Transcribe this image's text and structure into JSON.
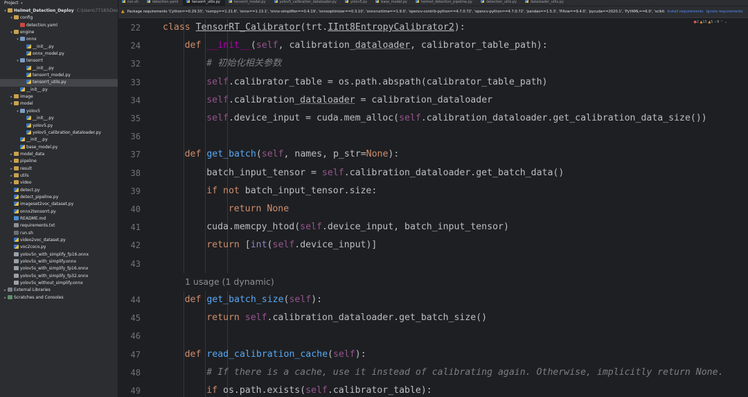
{
  "project": {
    "title": "Project",
    "tree": [
      {
        "indent": 0,
        "arrow": "▾",
        "icon": "folder",
        "label": "Helmet_Detection_Deploy",
        "hint": "C:\\Users\\77183\\Desktop\\He",
        "bold": true
      },
      {
        "indent": 1,
        "arrow": "▾",
        "icon": "folder",
        "label": "config"
      },
      {
        "indent": 2,
        "arrow": "",
        "icon": "yaml",
        "label": "detection.yaml"
      },
      {
        "indent": 1,
        "arrow": "▾",
        "icon": "folder",
        "label": "engine"
      },
      {
        "indent": 2,
        "arrow": "▾",
        "icon": "folder",
        "label": "onnx"
      },
      {
        "indent": 3,
        "arrow": "",
        "icon": "py",
        "label": "__init__.py"
      },
      {
        "indent": 3,
        "arrow": "",
        "icon": "py",
        "label": "onnx_model.py"
      },
      {
        "indent": 2,
        "arrow": "▾",
        "icon": "folder",
        "label": "tensorrt"
      },
      {
        "indent": 3,
        "arrow": "",
        "icon": "py",
        "label": "__init__.py"
      },
      {
        "indent": 3,
        "arrow": "",
        "icon": "py",
        "label": "tensorrt_model.py"
      },
      {
        "indent": 3,
        "arrow": "",
        "icon": "py",
        "label": "tensorrt_utils.py",
        "selected": true
      },
      {
        "indent": 2,
        "arrow": "",
        "icon": "py",
        "label": "__init__.py"
      },
      {
        "indent": 1,
        "arrow": "▸",
        "icon": "folder",
        "label": "image"
      },
      {
        "indent": 1,
        "arrow": "▾",
        "icon": "folder",
        "label": "model"
      },
      {
        "indent": 2,
        "arrow": "▾",
        "icon": "folder",
        "label": "yolov5"
      },
      {
        "indent": 3,
        "arrow": "",
        "icon": "py",
        "label": "__init__.py"
      },
      {
        "indent": 3,
        "arrow": "",
        "icon": "py",
        "label": "yolov5.py"
      },
      {
        "indent": 3,
        "arrow": "",
        "icon": "py",
        "label": "yolov5_calibration_dataloader.py"
      },
      {
        "indent": 2,
        "arrow": "",
        "icon": "py",
        "label": "__init__.py"
      },
      {
        "indent": 2,
        "arrow": "",
        "icon": "py",
        "label": "base_model.py"
      },
      {
        "indent": 1,
        "arrow": "▸",
        "icon": "folder",
        "label": "model_data"
      },
      {
        "indent": 1,
        "arrow": "▸",
        "icon": "folder",
        "label": "pipeline"
      },
      {
        "indent": 1,
        "arrow": "▸",
        "icon": "folder",
        "label": "result"
      },
      {
        "indent": 1,
        "arrow": "▸",
        "icon": "folder",
        "label": "utils"
      },
      {
        "indent": 1,
        "arrow": "▸",
        "icon": "folder",
        "label": "video"
      },
      {
        "indent": 1,
        "arrow": "",
        "icon": "py",
        "label": "detect.py"
      },
      {
        "indent": 1,
        "arrow": "",
        "icon": "py",
        "label": "detect_pipeline.py"
      },
      {
        "indent": 1,
        "arrow": "",
        "icon": "py",
        "label": "imageset2voc_dataset.py"
      },
      {
        "indent": 1,
        "arrow": "",
        "icon": "py",
        "label": "onnx2tensorrt.py"
      },
      {
        "indent": 1,
        "arrow": "",
        "icon": "md",
        "label": "README.md"
      },
      {
        "indent": 1,
        "arrow": "",
        "icon": "txt",
        "label": "requirements.txt"
      },
      {
        "indent": 1,
        "arrow": "",
        "icon": "sh",
        "label": "run.sh"
      },
      {
        "indent": 1,
        "arrow": "",
        "icon": "py",
        "label": "video2voc_dataset.py"
      },
      {
        "indent": 1,
        "arrow": "",
        "icon": "py",
        "label": "voc2coco.py"
      },
      {
        "indent": 1,
        "arrow": "",
        "icon": "onnx",
        "label": "yolov5n_with_simplify_fp16.onnx"
      },
      {
        "indent": 1,
        "arrow": "",
        "icon": "onnx",
        "label": "yolov5s_with_simplify.onnx"
      },
      {
        "indent": 1,
        "arrow": "",
        "icon": "onnx",
        "label": "yolov5s_with_simplify_fp16.onnx"
      },
      {
        "indent": 1,
        "arrow": "",
        "icon": "onnx",
        "label": "yolov5s_with_simplify_fp32.onnx"
      },
      {
        "indent": 1,
        "arrow": "",
        "icon": "onnx",
        "label": "yolov5s_without_simplify.onnx"
      },
      {
        "indent": 0,
        "arrow": "▸",
        "icon": "lib",
        "label": "External Libraries"
      },
      {
        "indent": 0,
        "arrow": "▸",
        "icon": "scratch",
        "label": "Scratches and Consoles"
      }
    ]
  },
  "tabs": [
    {
      "label": "run.sh"
    },
    {
      "label": "detection.yaml"
    },
    {
      "label": "tensorrt_utils.py",
      "active": true
    },
    {
      "label": "tensorrt_model.py"
    },
    {
      "label": "yolov5_calibration_dataloader.py"
    },
    {
      "label": "yolov5.py"
    },
    {
      "label": "base_model.py"
    },
    {
      "label": "helmet_detection_pipeline.py"
    },
    {
      "label": "detection_utils.py"
    },
    {
      "label": "dataloader_utils.py"
    }
  ],
  "banner": {
    "text": "Package requirements 'Cython==0.29.33', 'numpy==1.21.6', 'onnx==1.13.1', 'onnx-simplifier==0.4.19', 'onnxoptimizer==0.3.10', 'onnxruntime==1.9.0', 'opencv-contrib-python==4.7.0.72', 'opencv-python==4.7.0.72', 'pandas==1.5.3', 'Pillow==9.4.0', 'pycuda==2020.1', 'PyYAML==6.0', 'scikit-learn==1...",
    "install": "Install requirements",
    "ignore": "Ignore requirements"
  },
  "inspection": {
    "errors": "2",
    "warnings": "15",
    "weak": "5",
    "ok": "8"
  },
  "usage_hint": "1 usage (1 dynamic)",
  "code_lines": [
    {
      "num": "22",
      "indent": 0,
      "tokens": [
        [
          "kw",
          "class "
        ],
        [
          "cls",
          "TensorRT_Calibrator"
        ],
        [
          "",
          "(trt."
        ],
        [
          "cls",
          "IInt8EntropyCalibrator2"
        ],
        [
          "",
          "):"
        ]
      ]
    },
    {
      "num": "24",
      "indent": 1,
      "tokens": [
        [
          "kw",
          "def "
        ],
        [
          "dunder",
          "__init__"
        ],
        [
          "",
          "("
        ],
        [
          "selfc",
          "self"
        ],
        [
          "",
          ", calibration_"
        ],
        [
          "ul",
          "dataloader"
        ],
        [
          "",
          ", calibrator_table_path):"
        ]
      ]
    },
    {
      "num": "32",
      "indent": 2,
      "tokens": [
        [
          "cm",
          "# 初始化相关参数"
        ]
      ]
    },
    {
      "num": "33",
      "indent": 2,
      "tokens": [
        [
          "selfc",
          "self"
        ],
        [
          "",
          ".calibrator_table = os.path.abspath(calibrator_table_path)"
        ]
      ]
    },
    {
      "num": "34",
      "indent": 2,
      "tokens": [
        [
          "selfc",
          "self"
        ],
        [
          "",
          ".calibration_"
        ],
        [
          "ul",
          "dataloader"
        ],
        [
          "",
          " = calibration_dataloader"
        ]
      ]
    },
    {
      "num": "35",
      "indent": 2,
      "tokens": [
        [
          "selfc",
          "self"
        ],
        [
          "",
          ".device_input = cuda.mem_alloc("
        ],
        [
          "selfc",
          "self"
        ],
        [
          "",
          ".calibration_dataloader.get_calibration_data_size())"
        ]
      ]
    },
    {
      "num": "36",
      "indent": 0,
      "tokens": []
    },
    {
      "num": "37",
      "indent": 1,
      "tokens": [
        [
          "kw",
          "def "
        ],
        [
          "fn",
          "get_batch"
        ],
        [
          "",
          "("
        ],
        [
          "selfc",
          "self"
        ],
        [
          "",
          ", names, p_str="
        ],
        [
          "kw",
          "None"
        ],
        [
          "",
          "):"
        ]
      ]
    },
    {
      "num": "38",
      "indent": 2,
      "tokens": [
        [
          "",
          "batch_input_tensor = "
        ],
        [
          "selfc",
          "self"
        ],
        [
          "",
          ".calibration_dataloader.get_batch_data()"
        ]
      ]
    },
    {
      "num": "39",
      "indent": 2,
      "tokens": [
        [
          "kw",
          "if not "
        ],
        [
          "",
          "batch_input_tensor.size:"
        ]
      ]
    },
    {
      "num": "40",
      "indent": 3,
      "tokens": [
        [
          "kw",
          "return None"
        ]
      ]
    },
    {
      "num": "41",
      "indent": 2,
      "tokens": [
        [
          "",
          "cuda.memcpy_htod("
        ],
        [
          "selfc",
          "self"
        ],
        [
          "",
          ".device_input, batch_input_tensor)"
        ]
      ]
    },
    {
      "num": "42",
      "indent": 2,
      "tokens": [
        [
          "kw",
          "return "
        ],
        [
          "",
          "["
        ],
        [
          "builtin",
          "int"
        ],
        [
          "",
          "("
        ],
        [
          "selfc",
          "self"
        ],
        [
          "",
          ".device_input)]"
        ]
      ]
    },
    {
      "num": "43",
      "indent": 0,
      "tokens": []
    },
    {
      "num": "",
      "indent": 0,
      "inlay": true,
      "tokens": []
    },
    {
      "num": "44",
      "indent": 1,
      "tokens": [
        [
          "kw",
          "def "
        ],
        [
          "fn",
          "get_batch_size"
        ],
        [
          "",
          "("
        ],
        [
          "selfc",
          "self"
        ],
        [
          "",
          "):"
        ]
      ]
    },
    {
      "num": "45",
      "indent": 2,
      "tokens": [
        [
          "kw",
          "return "
        ],
        [
          "selfc",
          "self"
        ],
        [
          "",
          ".calibration_dataloader.get_batch_size()"
        ]
      ]
    },
    {
      "num": "46",
      "indent": 0,
      "tokens": []
    },
    {
      "num": "47",
      "indent": 1,
      "tokens": [
        [
          "kw",
          "def "
        ],
        [
          "fn",
          "read_calibration_cache"
        ],
        [
          "",
          "("
        ],
        [
          "selfc",
          "self"
        ],
        [
          "",
          "):"
        ]
      ]
    },
    {
      "num": "48",
      "indent": 2,
      "tokens": [
        [
          "cm",
          "# If there is a cache, use it instead of calibrating again. Otherwise, implicitly return None."
        ]
      ]
    },
    {
      "num": "49",
      "indent": 2,
      "tokens": [
        [
          "kw",
          "if "
        ],
        [
          "",
          "os.path.exists("
        ],
        [
          "selfc",
          "self"
        ],
        [
          "",
          ".calibrator_table):"
        ]
      ]
    }
  ]
}
